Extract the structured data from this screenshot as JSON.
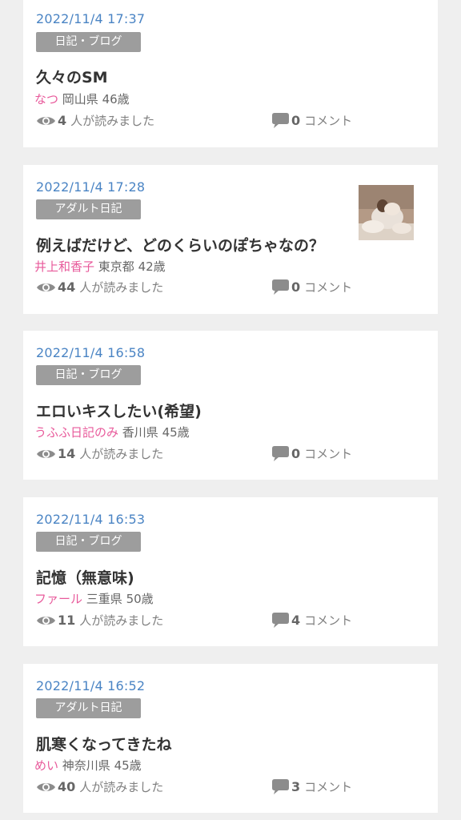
{
  "posts": [
    {
      "date": "2022/11/4 17:37",
      "category": "日記・ブログ",
      "title": "久々のSM",
      "author": "なつ",
      "location": "岡山県 46歳",
      "views_count": "4",
      "views_label": "人が読みました",
      "comments_count": "0",
      "comments_label": "コメント"
    },
    {
      "date": "2022/11/4 17:28",
      "category": "アダルト日記",
      "title": "例えばだけど、どのくらいのぽちゃなの？",
      "author": "井上和香子",
      "location": "東京都 42歳",
      "views_count": "44",
      "views_label": "人が読みました",
      "comments_count": "0",
      "comments_label": "コメント"
    },
    {
      "date": "2022/11/4 16:58",
      "category": "日記・ブログ",
      "title": "エロいキスしたい(希望)",
      "author": "うふふ日記のみ",
      "location": "香川県 45歳",
      "views_count": "14",
      "views_label": "人が読みました",
      "comments_count": "0",
      "comments_label": "コメント"
    },
    {
      "date": "2022/11/4 16:53",
      "category": "日記・ブログ",
      "title": "記憶（無意味)",
      "author": "ファール",
      "location": "三重県 50歳",
      "views_count": "11",
      "views_label": "人が読みました",
      "comments_count": "4",
      "comments_label": "コメント"
    },
    {
      "date": "2022/11/4 16:52",
      "category": "アダルト日記",
      "title": "肌寒くなってきたね",
      "author": "めい",
      "location": "神奈川県 45歳",
      "views_count": "40",
      "views_label": "人が読みました",
      "comments_count": "3",
      "comments_label": "コメント"
    }
  ],
  "colors": {
    "date": "#4a84c4",
    "author": "#e85a9b",
    "category_bg": "#9d9d9d",
    "background": "#efefef"
  },
  "icons": {
    "views": "eye-icon",
    "comments": "speech-bubble-icon"
  }
}
